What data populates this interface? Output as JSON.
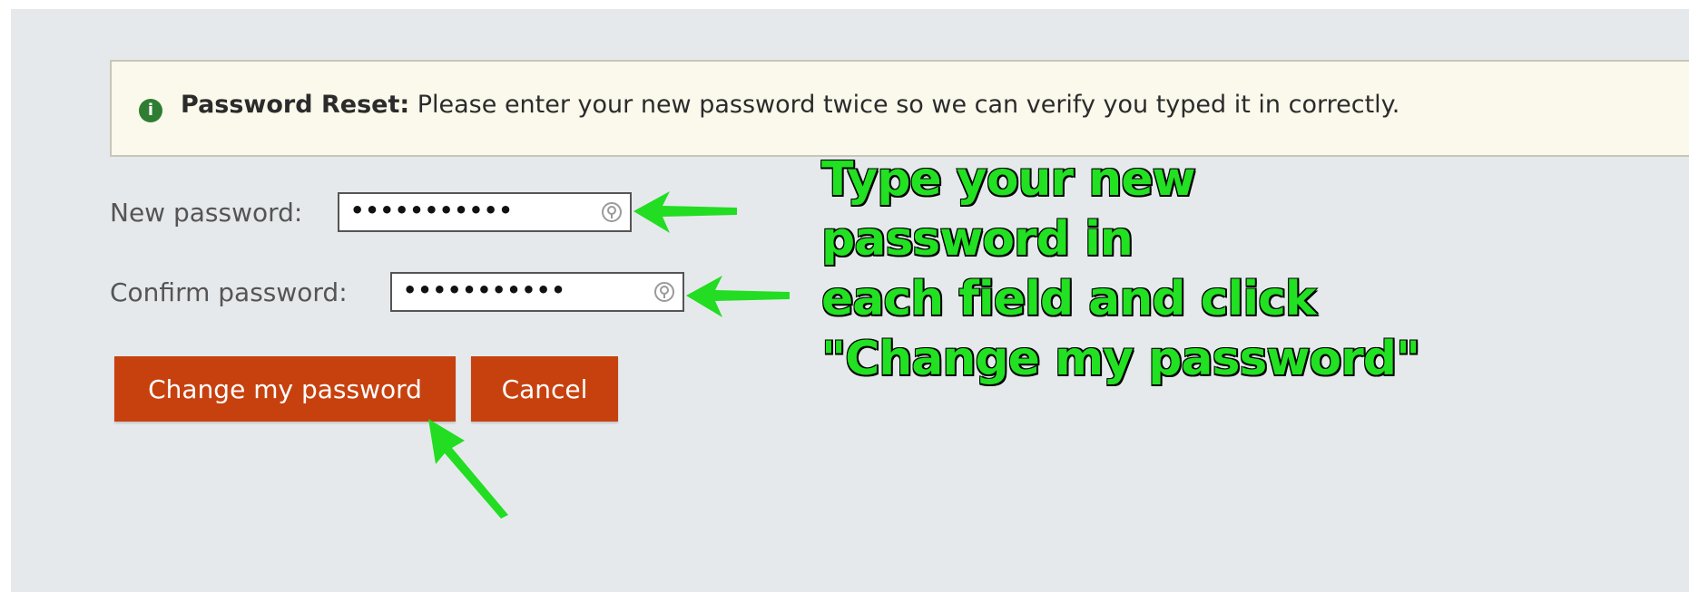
{
  "notice": {
    "icon": "info-icon",
    "icon_glyph": "i",
    "title": "Password Reset:",
    "message": " Please enter your new password twice so we can verify you typed it in correctly."
  },
  "form": {
    "new_password_label": "New password:",
    "new_password_value": "•••••••••••",
    "confirm_password_label": "Confirm password:",
    "confirm_password_value": "•••••••••••",
    "reveal_icon": "password-reveal-icon"
  },
  "buttons": {
    "change_label": "Change my password",
    "cancel_label": "Cancel"
  },
  "annotation": {
    "lines": [
      "Type your new",
      "password in",
      "each field and click",
      "\"Change my password\""
    ],
    "arrow_icon": "green-arrow-icon"
  },
  "colors": {
    "panel_bg": "#e6e9ec",
    "notice_bg": "#fbf8ec",
    "button_bg": "#c7410f",
    "info_icon": "#2e7d32",
    "annotation_green": "#22e022"
  }
}
